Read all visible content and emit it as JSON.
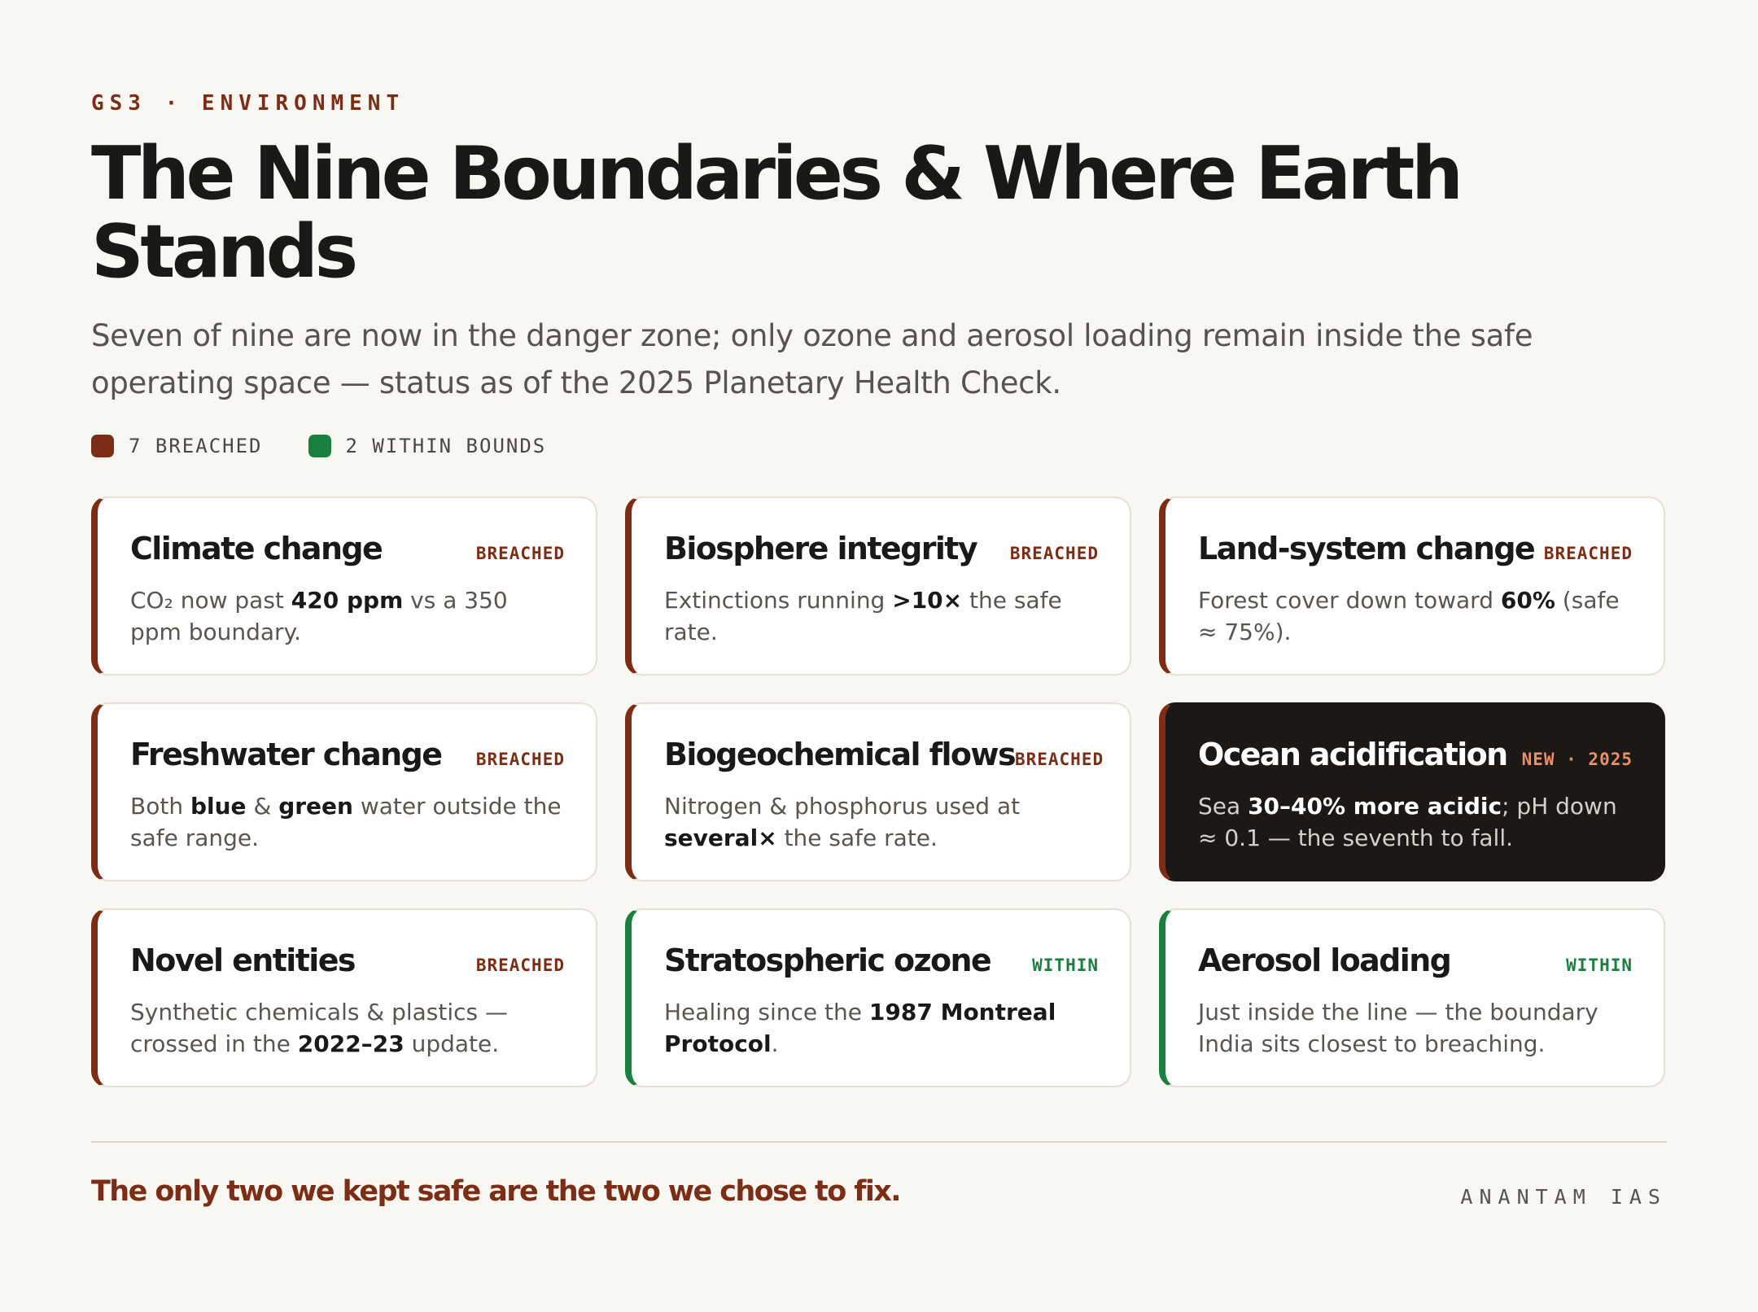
{
  "header": {
    "kicker": "GS3 · ENVIRONMENT",
    "title": "The Nine Boundaries & Where Earth Stands",
    "subtitle": "Seven of nine are now in the danger zone; only ozone and aerosol loading remain inside the safe operating space — status as of the 2025 Planetary Health Check."
  },
  "legend": {
    "breached_label": "7 BREACHED",
    "within_label": "2 WITHIN BOUNDS",
    "breached_color": "#7b2d15",
    "within_color": "#1a8040"
  },
  "cards": [
    {
      "title": "Climate change",
      "status": "BREACHED",
      "body": [
        {
          "t": "CO₂ now past "
        },
        {
          "t": "420 ppm",
          "b": true
        },
        {
          "t": " vs a 350 ppm boundary."
        }
      ]
    },
    {
      "title": "Biosphere integrity",
      "status": "BREACHED",
      "body": [
        {
          "t": "Extinctions running "
        },
        {
          "t": ">10×",
          "b": true
        },
        {
          "t": " the safe rate."
        }
      ]
    },
    {
      "title": "Land-system change",
      "status": "BREACHED",
      "body": [
        {
          "t": "Forest cover down toward "
        },
        {
          "t": "60%",
          "b": true
        },
        {
          "t": " (safe ≈ 75%)."
        }
      ]
    },
    {
      "title": "Freshwater change",
      "status": "BREACHED",
      "body": [
        {
          "t": "Both "
        },
        {
          "t": "blue",
          "b": true
        },
        {
          "t": " & "
        },
        {
          "t": "green",
          "b": true
        },
        {
          "t": " water outside the safe range."
        }
      ]
    },
    {
      "title": "Biogeochemical flows",
      "status": "BREACHED",
      "body": [
        {
          "t": "Nitrogen & phosphorus used at "
        },
        {
          "t": "several×",
          "b": true
        },
        {
          "t": " the safe rate."
        }
      ]
    },
    {
      "title": "Ocean acidification",
      "status": "NEW · 2025",
      "dark": true,
      "body": [
        {
          "t": "Sea "
        },
        {
          "t": "30–40% more acidic",
          "b": true
        },
        {
          "t": "; pH down ≈ 0.1 — the seventh to fall."
        }
      ]
    },
    {
      "title": "Novel entities",
      "status": "BREACHED",
      "body": [
        {
          "t": "Synthetic chemicals & plastics — crossed in the "
        },
        {
          "t": "2022–23",
          "b": true
        },
        {
          "t": " update."
        }
      ]
    },
    {
      "title": "Stratospheric ozone",
      "status": "WITHIN",
      "within": true,
      "body": [
        {
          "t": "Healing since the "
        },
        {
          "t": "1987 Montreal Protocol",
          "b": true
        },
        {
          "t": "."
        }
      ]
    },
    {
      "title": "Aerosol loading",
      "status": "WITHIN",
      "within": true,
      "body": [
        {
          "t": "Just inside the line — the boundary India sits closest to breaching."
        }
      ]
    }
  ],
  "footer": {
    "quote": "The only two we kept safe are the two we chose to fix.",
    "brand": "ANANTAM IAS"
  }
}
